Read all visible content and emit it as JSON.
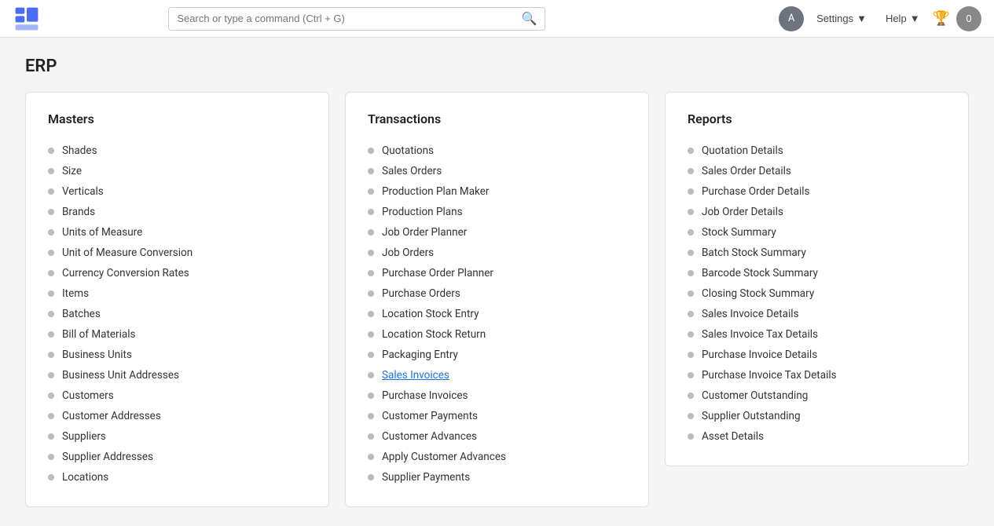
{
  "topnav": {
    "logo_alt": "App Logo",
    "search_placeholder": "Search or type a command (Ctrl + G)",
    "settings_label": "Settings",
    "help_label": "Help",
    "user_initial": "A",
    "notif_count": "0"
  },
  "page": {
    "title": "ERP"
  },
  "masters": {
    "heading": "Masters",
    "items": [
      {
        "label": "Shades"
      },
      {
        "label": "Size"
      },
      {
        "label": "Verticals"
      },
      {
        "label": "Brands"
      },
      {
        "label": "Units of Measure"
      },
      {
        "label": "Unit of Measure Conversion"
      },
      {
        "label": "Currency Conversion Rates"
      },
      {
        "label": "Items"
      },
      {
        "label": "Batches"
      },
      {
        "label": "Bill of Materials"
      },
      {
        "label": "Business Units"
      },
      {
        "label": "Business Unit Addresses"
      },
      {
        "label": "Customers"
      },
      {
        "label": "Customer Addresses"
      },
      {
        "label": "Suppliers"
      },
      {
        "label": "Supplier Addresses"
      },
      {
        "label": "Locations"
      }
    ]
  },
  "transactions": {
    "heading": "Transactions",
    "items": [
      {
        "label": "Quotations"
      },
      {
        "label": "Sales Orders"
      },
      {
        "label": "Production Plan Maker"
      },
      {
        "label": "Production Plans"
      },
      {
        "label": "Job Order Planner"
      },
      {
        "label": "Job Orders"
      },
      {
        "label": "Purchase Order Planner"
      },
      {
        "label": "Purchase Orders"
      },
      {
        "label": "Location Stock Entry"
      },
      {
        "label": "Location Stock Return"
      },
      {
        "label": "Packaging Entry"
      },
      {
        "label": "Sales Invoices",
        "active": true
      },
      {
        "label": "Purchase Invoices"
      },
      {
        "label": "Customer Payments"
      },
      {
        "label": "Customer Advances"
      },
      {
        "label": "Apply Customer Advances"
      },
      {
        "label": "Supplier Payments"
      }
    ]
  },
  "reports": {
    "heading": "Reports",
    "items": [
      {
        "label": "Quotation Details"
      },
      {
        "label": "Sales Order Details"
      },
      {
        "label": "Purchase Order Details"
      },
      {
        "label": "Job Order Details"
      },
      {
        "label": "Stock Summary"
      },
      {
        "label": "Batch Stock Summary"
      },
      {
        "label": "Barcode Stock Summary"
      },
      {
        "label": "Closing Stock Summary"
      },
      {
        "label": "Sales Invoice Details"
      },
      {
        "label": "Sales Invoice Tax Details"
      },
      {
        "label": "Purchase Invoice Details"
      },
      {
        "label": "Purchase Invoice Tax Details"
      },
      {
        "label": "Customer Outstanding"
      },
      {
        "label": "Supplier Outstanding"
      },
      {
        "label": "Asset Details"
      }
    ]
  }
}
